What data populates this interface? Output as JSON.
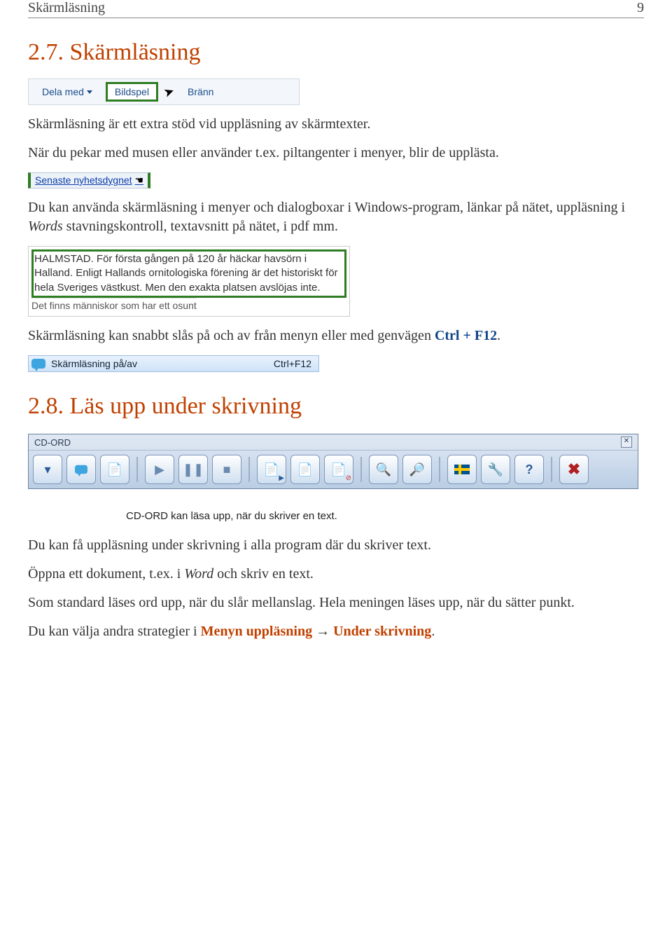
{
  "header": {
    "left": "Skärmläsning",
    "page": "9"
  },
  "section27": {
    "title": "2.7. Skärmläsning",
    "p1": "Skärmläsning är ett extra stöd vid uppläsning av skärmtexter.",
    "p2a": "När du pekar med musen eller använder t.ex. piltangenter i menyer, blir de upplästa.",
    "p3a": "Du kan använda skärmläsning i menyer och dialogboxar i Windows-program, länkar på nätet, uppläsning i ",
    "p3_em": "Words",
    "p3b": " stavningskontroll, textavsnitt på nätet, i pdf mm.",
    "p4a": "Skärmläsning kan snabbt slås på och av från menyn eller med genvägen ",
    "p4_shortcut": "Ctrl + F12",
    "p4b": "."
  },
  "explorer": {
    "dela": "Dela med",
    "bildspel": "Bildspel",
    "brann": "Bränn"
  },
  "link_snippet": "Senaste nyhetsdygnet",
  "news": {
    "selected": "HALMSTAD. För första gången på 120 år häckar havsörn i Halland. Enligt Hallands ornitologiska förening är det historiskt för hela Sveriges västkust. Men den exakta platsen avslöjas inte.",
    "below": "Det finns människor som har ett osunt"
  },
  "menu": {
    "label": "Skärmläsning på/av",
    "shortcut": "Ctrl+F12"
  },
  "section28": {
    "title": "2.8. Läs upp under skrivning",
    "note": "CD-ORD kan läsa upp, när du skriver en text.",
    "p1": "Du kan få uppläsning under skrivning i alla program där du skriver text.",
    "p2a": "Öppna ett dokument, t.ex. i ",
    "p2_em": "Word",
    "p2b": " och skriv en text.",
    "p3": "Som standard läses ord upp, när du slår mellanslag. Hela meningen läses upp, när du sätter punkt.",
    "p4a": "Du kan välja andra strategier i ",
    "p4_menu": "Menyn uppläsning",
    "p4_arrow": " → ",
    "p4_under": "Under skrivning",
    "p4b": "."
  },
  "cdord": {
    "title": "CD-ORD"
  }
}
